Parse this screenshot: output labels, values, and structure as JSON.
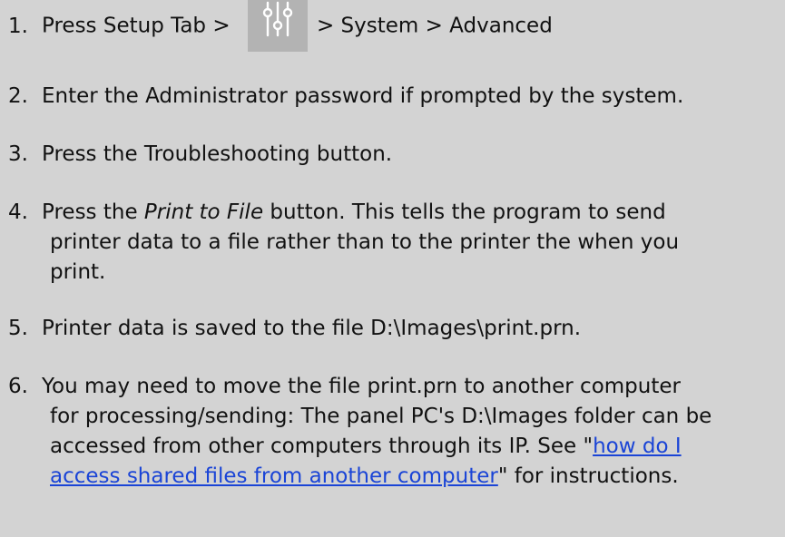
{
  "steps": {
    "s1": {
      "num": "1.",
      "before": "Press Setup Tab > ",
      "icon": "settings-sliders-icon",
      "after": "> System > Advanced"
    },
    "s2": {
      "num": "2.",
      "text": "Enter the Administrator password if prompted by the system."
    },
    "s3": {
      "num": "3.",
      "text": "Press the Troubleshooting button."
    },
    "s4": {
      "num": "4.",
      "before": "Press the ",
      "italic": "Print to File",
      "line1_after": " button. This tells the program to send",
      "line2": "printer data to a file rather than to the printer the when you",
      "line3": "print."
    },
    "s5": {
      "num": "5.",
      "text": "Printer data is saved to the file D:\\Images\\print.prn."
    },
    "s6": {
      "num": "6.",
      "line1": "You may need to move the file print.prn to another computer",
      "line2": "for processing/sending: The panel PC's D:\\Images folder can be",
      "line3_before": "accessed from other computers through its IP. See \"",
      "link_part1": "how do I",
      "link_part2": "access shared files from another computer",
      "line4_after": "\" for instructions."
    }
  },
  "colors": {
    "background": "#d3d3d3",
    "icon_tile": "#b3b3b3",
    "icon_stroke": "#ffffff",
    "link": "#1a44d6"
  }
}
